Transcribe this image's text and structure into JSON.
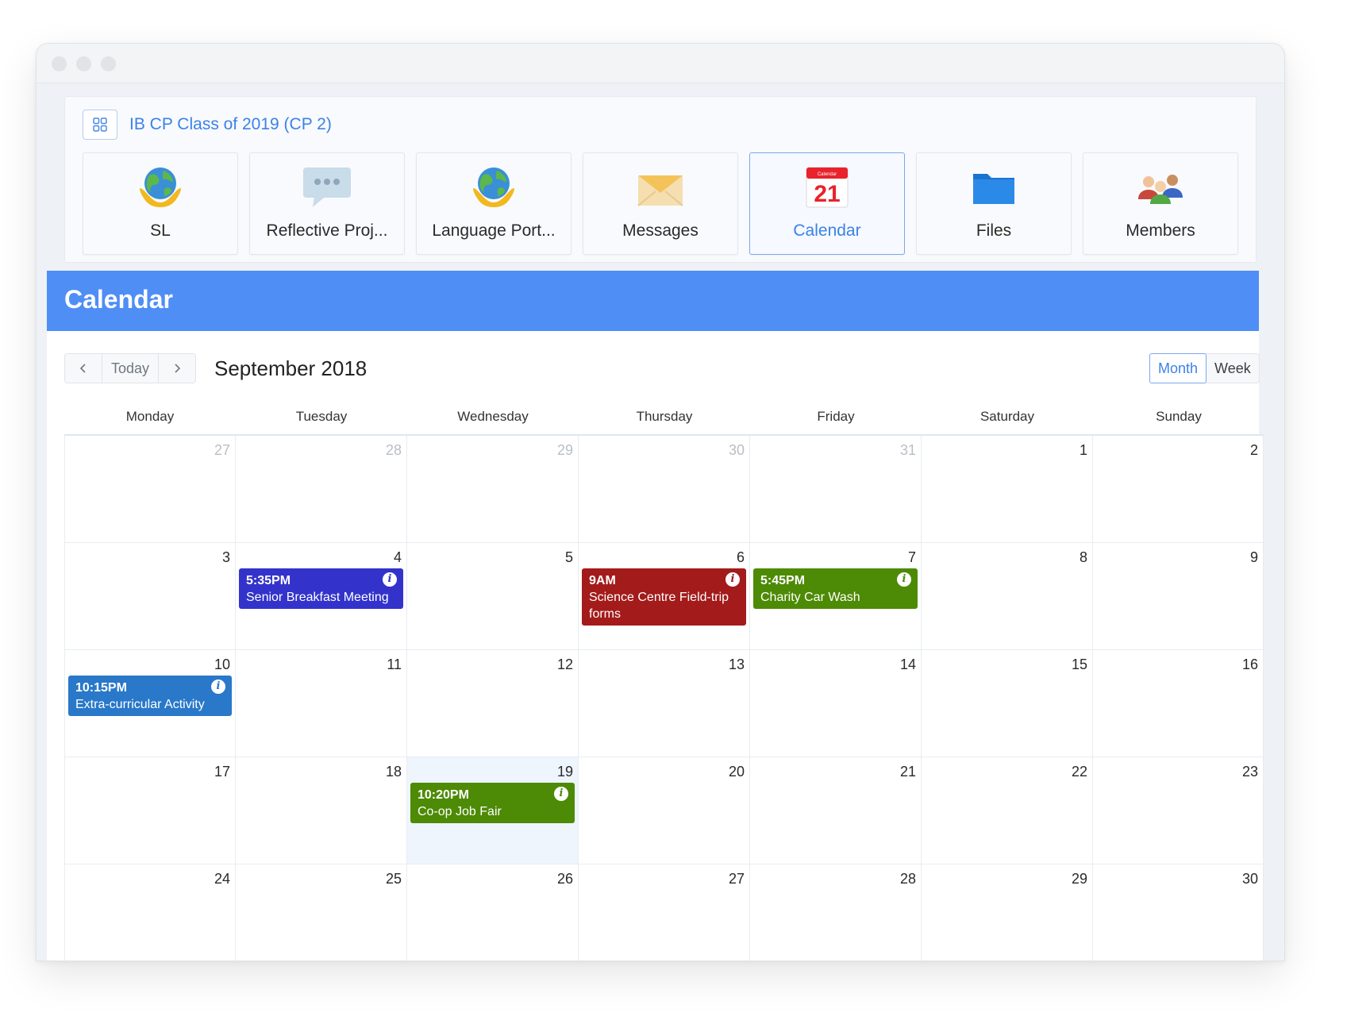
{
  "group": {
    "title": "IB CP Class of 2019 (CP 2)",
    "grid_icon": "grid-icon"
  },
  "tiles": [
    {
      "id": "sl",
      "label": "SL",
      "icon": "globe-hands-icon",
      "active": false
    },
    {
      "id": "reflective",
      "label": "Reflective Proj...",
      "icon": "speech-bubble-icon",
      "active": false
    },
    {
      "id": "language",
      "label": "Language Port...",
      "icon": "globe-hands-icon",
      "active": false
    },
    {
      "id": "messages",
      "label": "Messages",
      "icon": "envelope-icon",
      "active": false
    },
    {
      "id": "calendar",
      "label": "Calendar",
      "icon": "calendar-icon",
      "active": true,
      "calendar_day": "21",
      "calendar_caption": "Calendar"
    },
    {
      "id": "files",
      "label": "Files",
      "icon": "folder-icon",
      "active": false
    },
    {
      "id": "members",
      "label": "Members",
      "icon": "people-icon",
      "active": false
    }
  ],
  "calendar": {
    "header": "Calendar",
    "nav": {
      "today_label": "Today",
      "prev_icon": "chevron-left-icon",
      "next_icon": "chevron-right-icon"
    },
    "month_title": "September 2018",
    "views": [
      {
        "label": "Month",
        "active": true
      },
      {
        "label": "Week",
        "active": false
      }
    ],
    "weekdays": [
      "Monday",
      "Tuesday",
      "Wednesday",
      "Thursday",
      "Friday",
      "Saturday",
      "Sunday"
    ],
    "weeks": [
      [
        {
          "d": "27",
          "other": true
        },
        {
          "d": "28",
          "other": true
        },
        {
          "d": "29",
          "other": true
        },
        {
          "d": "30",
          "other": true
        },
        {
          "d": "31",
          "other": true
        },
        {
          "d": "1"
        },
        {
          "d": "2"
        }
      ],
      [
        {
          "d": "3"
        },
        {
          "d": "4"
        },
        {
          "d": "5"
        },
        {
          "d": "6"
        },
        {
          "d": "7"
        },
        {
          "d": "8"
        },
        {
          "d": "9"
        }
      ],
      [
        {
          "d": "10"
        },
        {
          "d": "11"
        },
        {
          "d": "12"
        },
        {
          "d": "13"
        },
        {
          "d": "14"
        },
        {
          "d": "15"
        },
        {
          "d": "16"
        }
      ],
      [
        {
          "d": "17"
        },
        {
          "d": "18"
        },
        {
          "d": "19",
          "today": true
        },
        {
          "d": "20"
        },
        {
          "d": "21"
        },
        {
          "d": "22"
        },
        {
          "d": "23"
        }
      ],
      [
        {
          "d": "24"
        },
        {
          "d": "25"
        },
        {
          "d": "26"
        },
        {
          "d": "27"
        },
        {
          "d": "28"
        },
        {
          "d": "29"
        },
        {
          "d": "30"
        }
      ]
    ],
    "events": [
      {
        "week": 1,
        "day": 1,
        "time": "5:35PM",
        "title": "Senior Breakfast Meeting",
        "color": "#3333cc",
        "icon": "info-icon"
      },
      {
        "week": 1,
        "day": 3,
        "time": "9AM",
        "title": "Science Centre Field-trip forms",
        "color": "#a31b1b",
        "icon": "info-icon"
      },
      {
        "week": 1,
        "day": 4,
        "time": "5:45PM",
        "title": "Charity Car Wash",
        "color": "#4d8a05",
        "icon": "info-icon"
      },
      {
        "week": 2,
        "day": 0,
        "time": "10:15PM",
        "title": "Extra-curricular Activity",
        "color": "#2978c9",
        "icon": "info-icon"
      },
      {
        "week": 3,
        "day": 2,
        "time": "10:20PM",
        "title": "Co-op Job Fair",
        "color": "#4d8a05",
        "icon": "info-icon"
      }
    ]
  }
}
